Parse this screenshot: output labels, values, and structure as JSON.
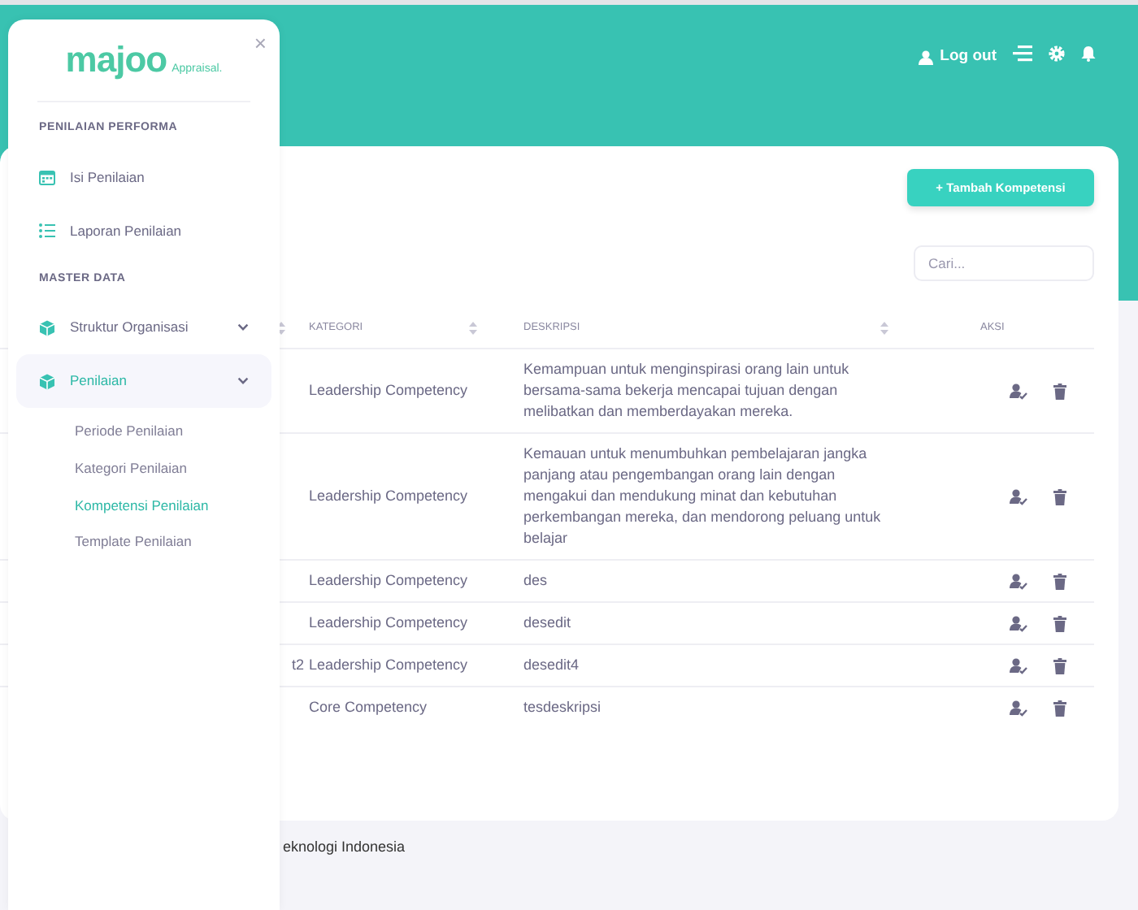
{
  "header": {
    "logout": "Log out"
  },
  "sidebar": {
    "logo": "majoo",
    "logo_suffix": "Appraisal.",
    "close": "×",
    "sections": [
      {
        "title": "PENILAIAN PERFORMA",
        "items": [
          {
            "label": "Isi Penilaian",
            "kind": "calendar",
            "selected": false
          },
          {
            "label": "Laporan Penilaian",
            "kind": "list",
            "selected": false
          }
        ]
      },
      {
        "title": "MASTER DATA",
        "items": [
          {
            "label": "Struktur Organisasi",
            "kind": "box",
            "selected": false,
            "expandable": true
          },
          {
            "label": "Penilaian",
            "kind": "box",
            "selected": true,
            "expandable": true,
            "children": [
              {
                "label": "Periode Penilaian",
                "selected": false
              },
              {
                "label": "Kategori Penilaian",
                "selected": false
              },
              {
                "label": "Kompetensi Penilaian",
                "selected": true
              },
              {
                "label": "Template Penilaian",
                "selected": false
              }
            ]
          }
        ]
      }
    ]
  },
  "add_button": "+ Tambah Kompetensi",
  "search": {
    "placeholder": "Cari..."
  },
  "table": {
    "columns": [
      {
        "sortable": true
      },
      {
        "label": "KATEGORI",
        "sortable": true
      },
      {
        "label": "DESKRIPSI",
        "sortable": true
      },
      {
        "label": "AKSI",
        "sortable": false
      }
    ],
    "rows": [
      {
        "kategori": "Leadership Competency",
        "deskripsi": "Kemampuan untuk menginspirasi orang lain untuk bersama-sama bekerja mencapai tujuan dengan melibatkan dan memberdayakan mereka."
      },
      {
        "kategori": "Leadership Competency",
        "deskripsi": "Kemauan untuk menumbuhkan pembelajaran jangka panjang atau pengembangan orang lain dengan mengakui dan mendukung minat dan kebutuhan perkembangan mereka, dan mendorong peluang untuk belajar"
      },
      {
        "kategori": "Leadership Competency",
        "deskripsi": "des"
      },
      {
        "kategori": "Leadership Competency",
        "deskripsi": "desedit"
      },
      {
        "column_1": "t2",
        "kategori": "Leadership Competency",
        "deskripsi": "desedit4"
      },
      {
        "kategori": "Core Competency",
        "deskripsi": "tesdeskripsi"
      }
    ]
  },
  "footer": "eknologi Indonesia"
}
